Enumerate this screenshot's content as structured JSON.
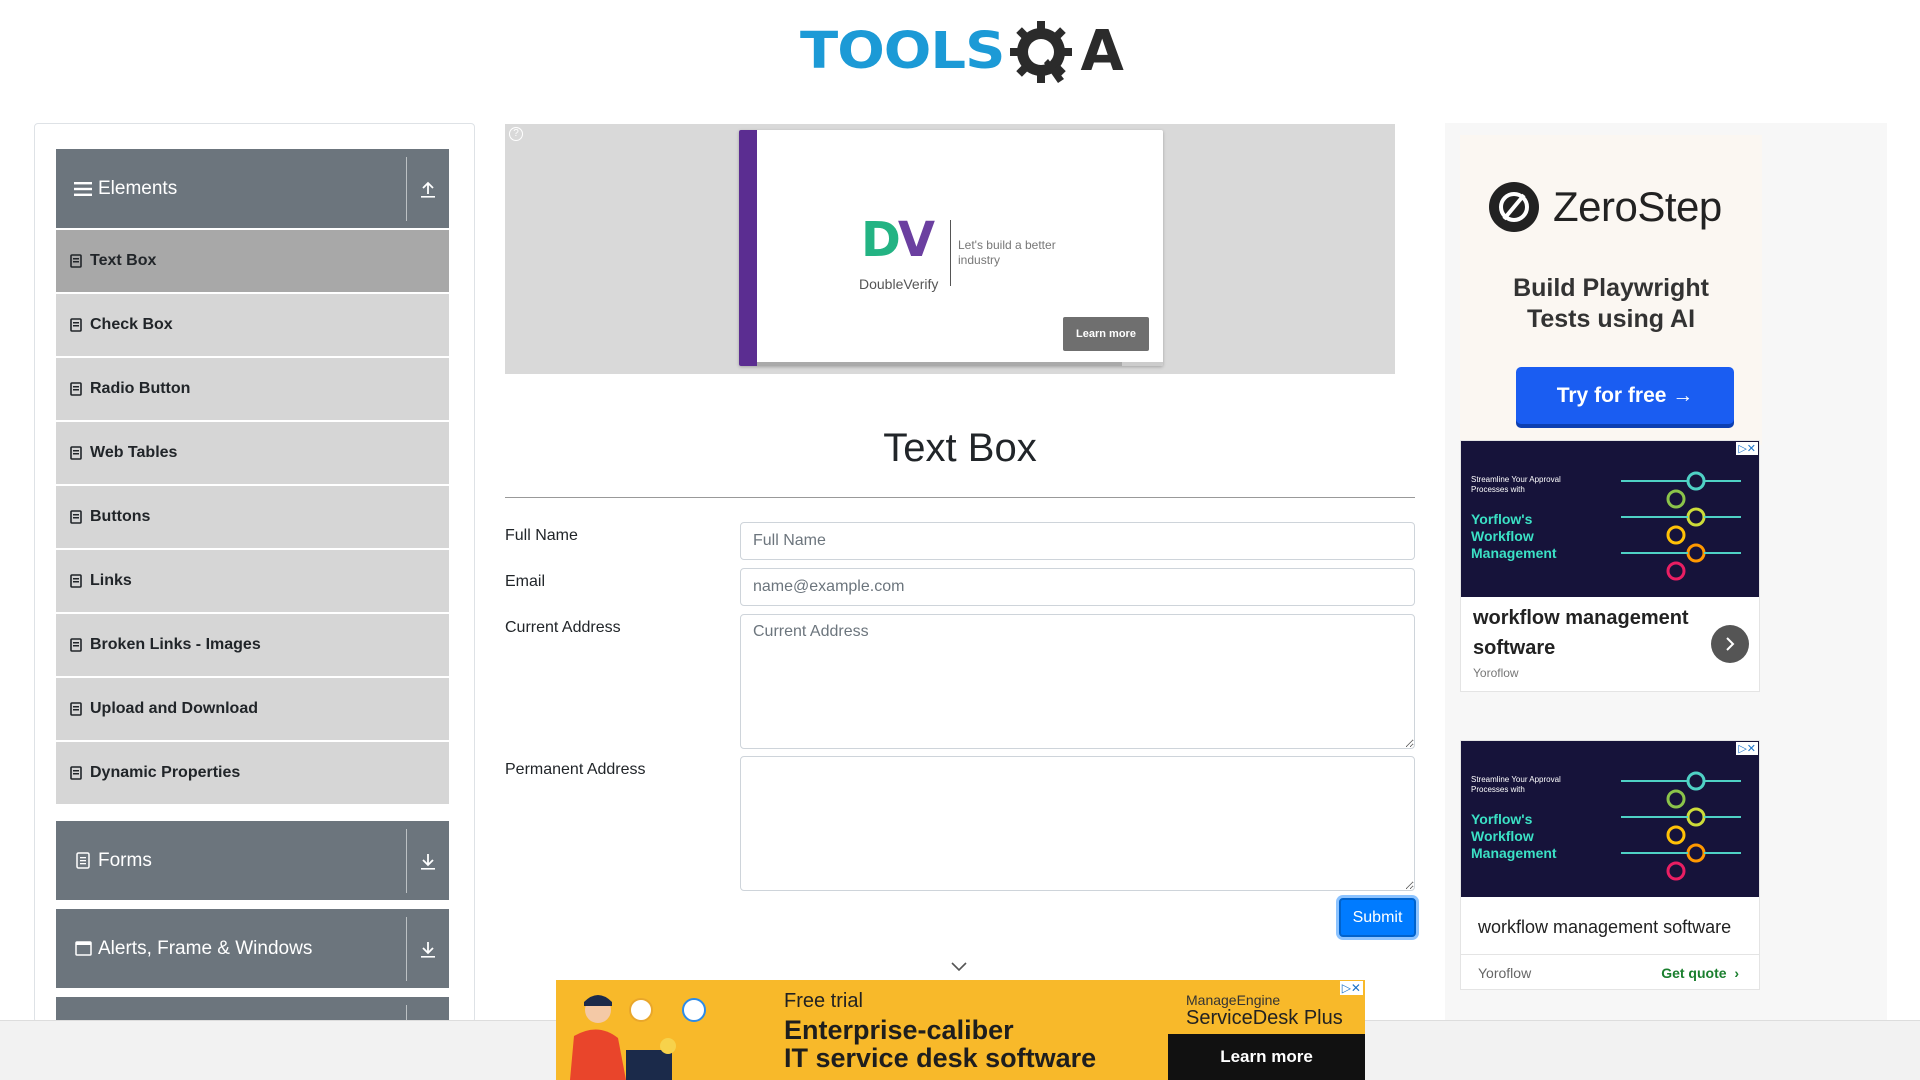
{
  "header": {
    "logo_primary": "TOOLS",
    "logo_secondary": "A",
    "logo_icon": "gear-q-icon"
  },
  "sidebar": {
    "groups": [
      {
        "label": "Elements",
        "icon": "hamburger-icon",
        "toggle_icon": "arrow-up-icon",
        "expanded": true
      },
      {
        "label": "Forms",
        "icon": "document-icon",
        "toggle_icon": "arrow-down-icon",
        "expanded": false
      },
      {
        "label": "Alerts, Frame & Windows",
        "icon": "window-icon",
        "toggle_icon": "arrow-down-icon",
        "expanded": false
      }
    ],
    "items": [
      {
        "label": "Text Box",
        "active": true
      },
      {
        "label": "Check Box",
        "active": false
      },
      {
        "label": "Radio Button",
        "active": false
      },
      {
        "label": "Web Tables",
        "active": false
      },
      {
        "label": "Buttons",
        "active": false
      },
      {
        "label": "Links",
        "active": false
      },
      {
        "label": "Broken Links - Images",
        "active": false
      },
      {
        "label": "Upload and Download",
        "active": false
      },
      {
        "label": "Dynamic Properties",
        "active": false
      }
    ]
  },
  "top_ad": {
    "brand_mark": "DV",
    "brand_name": "DoubleVerify",
    "tagline": "Let's build a better industry",
    "button": "Learn more"
  },
  "main": {
    "title": "Text Box",
    "fields": {
      "full_name": {
        "label": "Full Name",
        "placeholder": "Full Name",
        "value": ""
      },
      "email": {
        "label": "Email",
        "placeholder": "name@example.com",
        "value": ""
      },
      "current_address": {
        "label": "Current Address",
        "placeholder": "Current Address",
        "value": ""
      },
      "permanent_address": {
        "label": "Permanent Address",
        "placeholder": "",
        "value": ""
      }
    },
    "submit_label": "Submit"
  },
  "right_ads": {
    "zerostep": {
      "brand": "ZeroStep",
      "tagline": "Build Playwright Tests using AI",
      "button": "Try for free →"
    },
    "workflow_1": {
      "image_small": "Streamline Your Approval Processes with",
      "image_big": "Yorflow's Workflow Management",
      "title": "workflow management software",
      "advertiser": "Yoroflow"
    },
    "workflow_2": {
      "image_small": "Streamline Your Approval Processes with",
      "image_big": "Yorflow's Workflow Management",
      "title": "workflow management software",
      "advertiser": "Yoroflow",
      "cta": "Get quote"
    }
  },
  "bottom_ad": {
    "eyebrow": "Free trial",
    "headline_line1": "Enterprise-caliber",
    "headline_line2": "IT service desk software",
    "brand_line1": "ManageEngine",
    "brand_line2": "ServiceDesk Plus",
    "button": "Learn more"
  },
  "colors": {
    "accent": "#007bff",
    "sidebar_group": "#6c757d",
    "sidebar_item": "#d6d6d6",
    "sidebar_item_active": "#a8a8a8",
    "logo_blue": "#1c9ad6",
    "bottom_ad_bg": "#f8b92a",
    "zerostep_button": "#1a5df2"
  }
}
